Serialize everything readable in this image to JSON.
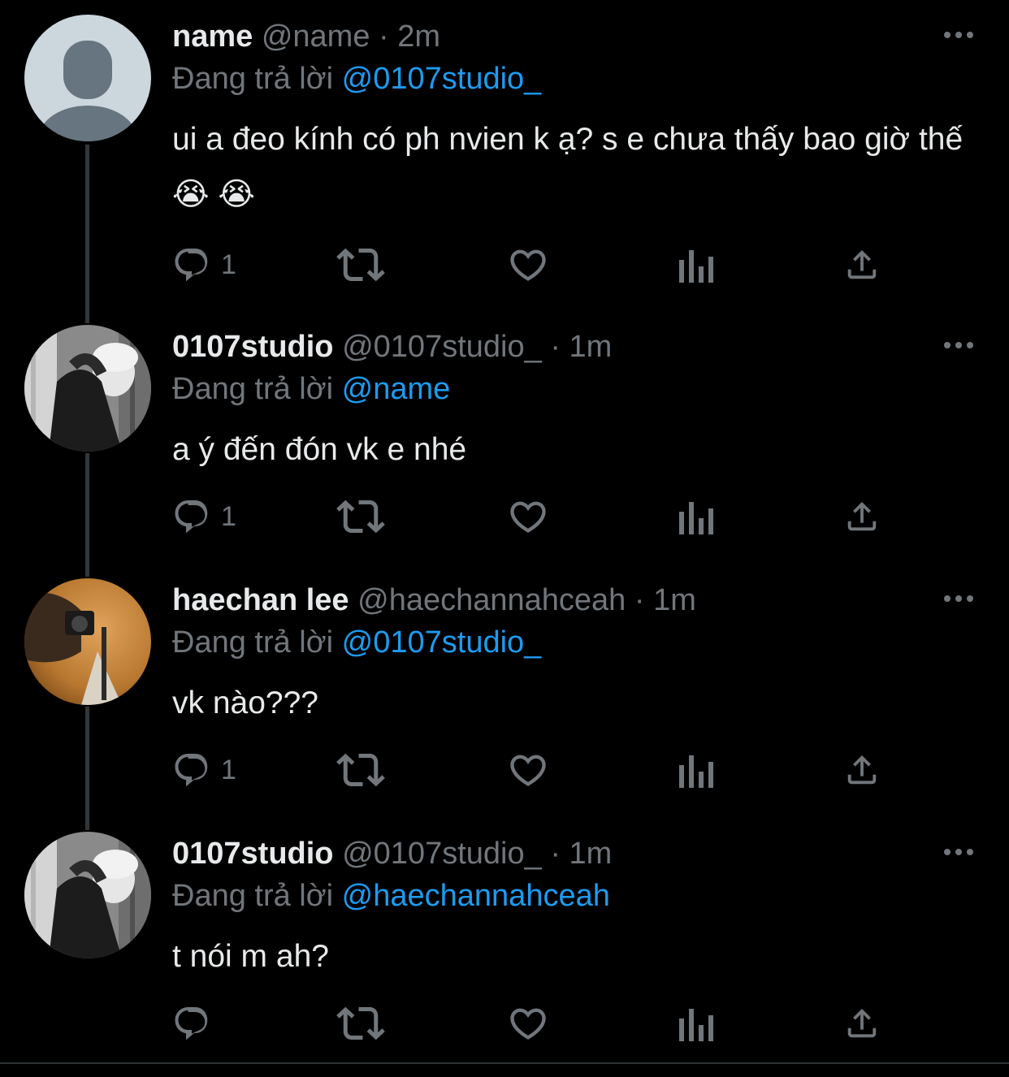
{
  "colors": {
    "background": "#000000",
    "text": "#e7e9ea",
    "secondary": "#71767b",
    "link": "#1d9bf0",
    "thread_line": "#333639"
  },
  "reply_prefix": "Đang trả lời",
  "tweets": [
    {
      "display_name": "name",
      "handle": "@name",
      "separator": "·",
      "time": "2m",
      "replying_to": "@0107studio_",
      "text": "ui a đeo kính có ph nvien k ạ? s e chưa thấy bao giờ thế😭 😭",
      "reply_count": "1",
      "avatar": "default-avatar"
    },
    {
      "display_name": "0107studio",
      "handle": "@0107studio_",
      "separator": "·",
      "time": "1m",
      "replying_to": "@name",
      "text": "a ý đến đón vk e nhé",
      "reply_count": "1",
      "avatar": "bw-photo-avatar"
    },
    {
      "display_name": "haechan lee",
      "handle": "@haechannahceah",
      "separator": "·",
      "time": "1m",
      "replying_to": "@0107studio_",
      "text": "vk nào???",
      "reply_count": "1",
      "avatar": "warm-photo-avatar"
    },
    {
      "display_name": "0107studio",
      "handle": "@0107studio_",
      "separator": "·",
      "time": "1m",
      "replying_to": "@haechannahceah",
      "text": "t nói m ah?",
      "reply_count": "",
      "avatar": "bw-photo-avatar"
    }
  ],
  "icons": [
    "reply-icon",
    "retweet-icon",
    "like-icon",
    "analytics-icon",
    "share-icon",
    "more-icon"
  ]
}
